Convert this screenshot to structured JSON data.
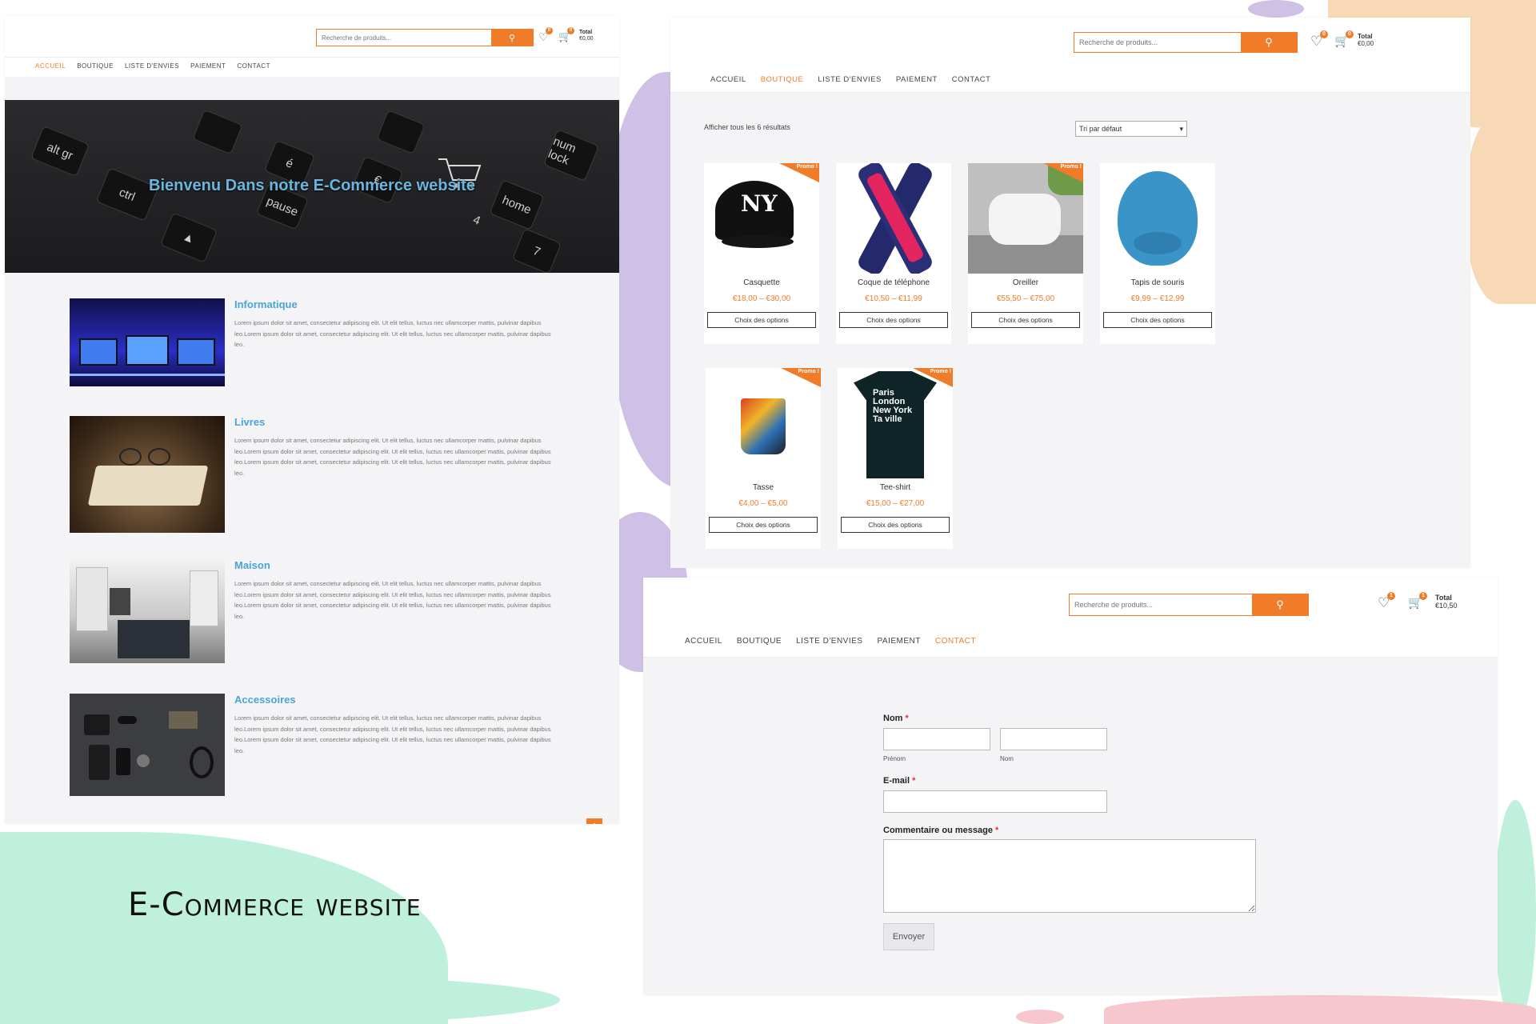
{
  "showcase_title": "E-Commerce website",
  "colors": {
    "accent": "#f07c2a",
    "link_blue": "#4aa4d6",
    "panel_bg": "#f4f4f7"
  },
  "header": {
    "search_placeholder": "Recherche de produits...",
    "search_icon": "search-icon",
    "wishlist_icon": "heart-icon",
    "cart_icon": "basket-icon",
    "total_label": "Total"
  },
  "nav_items": [
    "Accueil",
    "Boutique",
    "Liste d'envies",
    "Paiement",
    "Contact"
  ],
  "home": {
    "wishlist_count": "0",
    "cart_count": "0",
    "cart_total": "€0,00",
    "active_nav": "Accueil",
    "hero_title": "Bienvenu Dans notre E-Commerce website",
    "hero_keys": [
      "alt gr",
      "ctrl",
      "num lock",
      "home",
      "pause",
      "7",
      "4",
      "€",
      "é"
    ],
    "categories": [
      {
        "title": "Informatique",
        "text": "Lorem ipsum dolor sit amet, consectetur adipiscing elit. Ut elit tellus, luctus nec ullamcorper mattis, pulvinar dapibus leo.Lorem ipsum dolor sit amet, consectetur adipiscing elit. Ut elit tellus, luctus nec ullamcorper mattis, pulvinar dapibus leo."
      },
      {
        "title": "Livres",
        "text": "Lorem ipsum dolor sit amet, consectetur adipiscing elit. Ut elit tellus, luctus nec ullamcorper mattis, pulvinar dapibus leo.Lorem ipsum dolor sit amet, consectetur adipiscing elit. Ut elit tellus, luctus nec ullamcorper mattis, pulvinar dapibus leo.Lorem ipsum dolor sit amet, consectetur adipiscing elit. Ut elit tellus, luctus nec ullamcorper mattis, pulvinar dapibus leo."
      },
      {
        "title": "Maison",
        "text": "Lorem ipsum dolor sit amet, consectetur adipiscing elit. Ut elit tellus, luctus nec ullamcorper mattis, pulvinar dapibus leo.Lorem ipsum dolor sit amet, consectetur adipiscing elit. Ut elit tellus, luctus nec ullamcorper mattis, pulvinar dapibus leo.Lorem ipsum dolor sit amet, consectetur adipiscing elit. Ut elit tellus, luctus nec ullamcorper mattis, pulvinar dapibus leo."
      },
      {
        "title": "Accessoires",
        "text": "Lorem ipsum dolor sit amet, consectetur adipiscing elit. Ut elit tellus, luctus nec ullamcorper mattis, pulvinar dapibus leo.Lorem ipsum dolor sit amet, consectetur adipiscing elit. Ut elit tellus, luctus nec ullamcorper mattis, pulvinar dapibus leo.Lorem ipsum dolor sit amet, consectetur adipiscing elit. Ut elit tellus, luctus nec ullamcorper mattis, pulvinar dapibus leo."
      }
    ],
    "scroll_top_icon": "chevron-up-icon"
  },
  "shop": {
    "wishlist_count": "0",
    "cart_count": "0",
    "cart_total": "€0,00",
    "active_nav": "Boutique",
    "results_text": "Afficher tous les 6 résultats",
    "sort_selected": "Tri par défaut",
    "promo_label": "Promo !",
    "options_button": "Choix des options",
    "products": [
      {
        "name": "Casquette",
        "price": "€18,00 – €30,00",
        "promo": true,
        "cap_print": "NY"
      },
      {
        "name": "Coque de téléphone",
        "price": "€10,50 – €11,99",
        "promo": false
      },
      {
        "name": "Oreiller",
        "price": "€55,50 – €75,00",
        "promo": true
      },
      {
        "name": "Tapis de souris",
        "price": "€9,99 – €12,99",
        "promo": false
      },
      {
        "name": "Tasse",
        "price": "€4,00 – €5,00",
        "promo": true
      },
      {
        "name": "Tee-shirt",
        "price": "€15,00 – €27,00",
        "promo": true,
        "shirt_print": "Paris London New York Ta ville"
      }
    ]
  },
  "contact": {
    "wishlist_count": "1",
    "cart_count": "1",
    "cart_total": "€10,50",
    "active_nav": "Contact",
    "name_label": "Nom",
    "first_name_sub": "Prénom",
    "last_name_sub": "Nom",
    "email_label": "E-mail",
    "message_label": "Commentaire ou message",
    "required_mark": "*",
    "submit_button": "Envoyer"
  }
}
